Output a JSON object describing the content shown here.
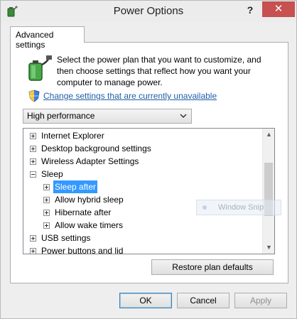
{
  "window": {
    "title": "Power Options",
    "help_label": "?",
    "close_label": "✕"
  },
  "tab": {
    "label": "Advanced settings"
  },
  "panel": {
    "description": "Select the power plan that you want to customize, and then choose settings that reflect how you want your computer to manage power.",
    "change_link": "Change settings that are currently unavailable"
  },
  "plan_select": {
    "value": "High performance"
  },
  "tree": {
    "items": [
      {
        "label": "Internet Explorer",
        "expander": "plus",
        "level": 0,
        "selected": false
      },
      {
        "label": "Desktop background settings",
        "expander": "plus",
        "level": 0,
        "selected": false
      },
      {
        "label": "Wireless Adapter Settings",
        "expander": "plus",
        "level": 0,
        "selected": false
      },
      {
        "label": "Sleep",
        "expander": "minus",
        "level": 0,
        "selected": false
      },
      {
        "label": "Sleep after",
        "expander": "plus",
        "level": 1,
        "selected": true
      },
      {
        "label": "Allow hybrid sleep",
        "expander": "plus",
        "level": 1,
        "selected": false
      },
      {
        "label": "Hibernate after",
        "expander": "plus",
        "level": 1,
        "selected": false
      },
      {
        "label": "Allow wake timers",
        "expander": "plus",
        "level": 1,
        "selected": false
      },
      {
        "label": "USB settings",
        "expander": "plus",
        "level": 0,
        "selected": false
      },
      {
        "label": "Power buttons and lid",
        "expander": "plus",
        "level": 0,
        "selected": false
      }
    ]
  },
  "buttons": {
    "restore": "Restore plan defaults",
    "ok": "OK",
    "cancel": "Cancel",
    "apply": "Apply"
  },
  "overlay": {
    "label": "Window Snip"
  },
  "colors": {
    "close_button": "#c75050",
    "link": "#1e5ea8",
    "selection": "#3399ff"
  }
}
